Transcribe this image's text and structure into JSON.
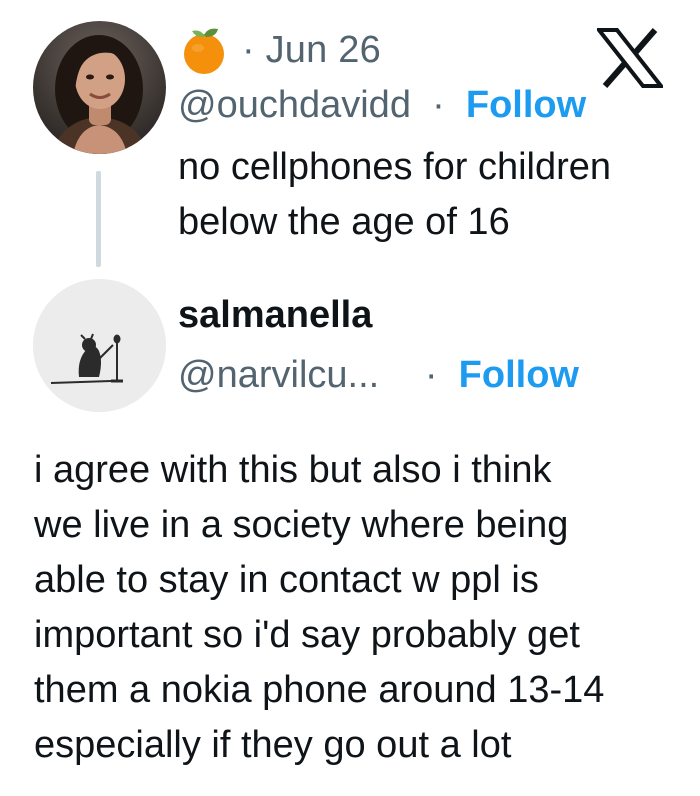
{
  "original_post": {
    "date_text": "· Jun 26",
    "handle": "@ouchdavidd",
    "separator": "·",
    "follow_label": "Follow",
    "text_lines": [
      "no cellphones for children",
      "below the age of 16"
    ],
    "emoji_icon": "tangerine-emoji-icon"
  },
  "reply": {
    "display_name": "salmanella",
    "handle": "@narvilcu...",
    "separator": "·",
    "follow_label": "Follow",
    "text_lines": [
      "i agree with this but also i think",
      "we live in a society where being",
      "able to stay in contact w ppl is",
      "important so i'd say probably get",
      "them a nokia phone around 13-14",
      "especially if they go out a lot"
    ]
  },
  "brand": {
    "logo_icon": "x-logo-icon"
  },
  "colors": {
    "follow": "#1d9bf0",
    "secondary_text": "#536471",
    "primary_text": "#0f1419",
    "thread_line": "#cfd9de"
  }
}
